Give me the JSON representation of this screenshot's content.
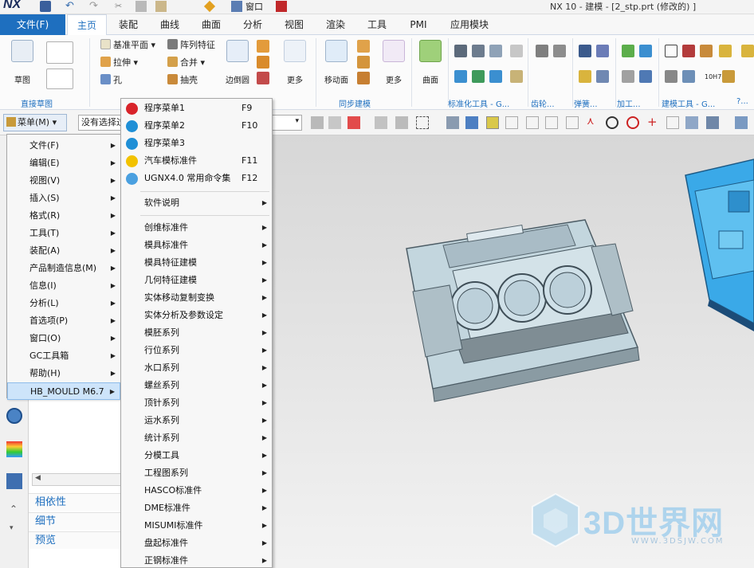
{
  "titlebar": {
    "logo": "NX",
    "window_menu": "窗口",
    "title": "NX 10 - 建模 - [2_stp.prt  (修改的) ]"
  },
  "ribbon_tabs": {
    "file": "文件(F)",
    "tabs": [
      "主页",
      "装配",
      "曲线",
      "曲面",
      "分析",
      "视图",
      "渲染",
      "工具",
      "PMI",
      "应用模块"
    ],
    "active": "主页"
  },
  "ribbon": {
    "sketch": "草图",
    "direct_sketch": "直接草图",
    "datum_plane": "基准平面",
    "extrude": "拉伸",
    "hole": "孔",
    "pattern_feature": "阵列特征",
    "unite": "合并",
    "shell": "抽壳",
    "edge_blend": "边倒圆",
    "more1": "更多",
    "move_face": "移动面",
    "more2": "更多",
    "sync_modeling": "同步建模",
    "surface": "曲面",
    "std_tools": "标准化工具 - G...",
    "gear": "齿轮...",
    "spring": "弹簧...",
    "machining": "加工...",
    "modeling_tools": "建模工具 - G...",
    "more_dots": "?...",
    "text_10h7": "10H7"
  },
  "toolbar2": {
    "menu_label": "菜单(M)",
    "filter_value": "没有选择过滤器"
  },
  "menu1": {
    "items": [
      {
        "label": "文件(F)",
        "sub": true
      },
      {
        "label": "编辑(E)",
        "sub": true
      },
      {
        "label": "视图(V)",
        "sub": true
      },
      {
        "label": "插入(S)",
        "sub": true
      },
      {
        "label": "格式(R)",
        "sub": true
      },
      {
        "label": "工具(T)",
        "sub": true
      },
      {
        "label": "装配(A)",
        "sub": true
      },
      {
        "label": "产品制造信息(M)",
        "sub": true
      },
      {
        "label": "信息(I)",
        "sub": true
      },
      {
        "label": "分析(L)",
        "sub": true
      },
      {
        "label": "首选项(P)",
        "sub": true
      },
      {
        "label": "窗口(O)",
        "sub": true
      },
      {
        "label": "GC工具箱",
        "sub": true
      },
      {
        "label": "帮助(H)",
        "sub": true
      },
      {
        "label": "HB_MOULD M6.7",
        "sub": true,
        "active": true
      }
    ]
  },
  "menu2": {
    "top_items": [
      {
        "label": "程序菜单1",
        "shortcut": "F9",
        "icon_color": "#d8232a"
      },
      {
        "label": "程序菜单2",
        "shortcut": "F10",
        "icon_color": "#1f8fd6"
      },
      {
        "label": "程序菜单3",
        "shortcut": "",
        "icon_color": "#1f8fd6"
      },
      {
        "label": "汽车模标准件",
        "shortcut": "F11",
        "icon_color": "#f2c200"
      },
      {
        "label": "UGNX4.0 常用命令集",
        "shortcut": "F12",
        "icon_color": "#4aa0e0"
      }
    ],
    "software_info": "软件说明",
    "items": [
      "创维标准件",
      "模具标准件",
      "模具特征建模",
      "几何特征建模",
      "实体移动复制变换",
      "实体分析及参数设定",
      "模胚系列",
      "行位系列",
      "水口系列",
      "螺丝系列",
      "顶针系列",
      "运水系列",
      "统计系列",
      "分模工具",
      "工程图系列",
      "HASCO标准件",
      "DME标准件",
      "MISUMI标准件",
      "盘起标准件",
      "正钢标准件"
    ]
  },
  "navigator": {
    "dependencies": "相依性",
    "details": "细节",
    "preview": "预览"
  },
  "watermark": {
    "brand": "3D世界网",
    "url": "WWW.3DSJW.COM"
  },
  "colors": {
    "accent": "#1e6fbf",
    "menu_hover": "#cde4fa",
    "part_body": "#c3d6de",
    "part_blue": "#3aa9e8"
  }
}
